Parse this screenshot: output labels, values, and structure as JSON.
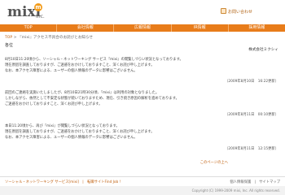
{
  "header": {
    "logo_text": "mixi",
    "logo_badge": "m",
    "logo_suffix": "Inc.",
    "util_link": "お問い合わせ"
  },
  "nav": {
    "items": [
      "TOP",
      "会社情報",
      "広報情報",
      "IR情報",
      "採用情報"
    ]
  },
  "breadcrumb": {
    "top": "TOP",
    "separator": " > ",
    "current": "『mixi』アクセス不具合のお詫びとお知らせ"
  },
  "section_title": "各位",
  "company": "株式会社ミクシィ",
  "paragraphs": [
    {
      "lines": [
        "8月10日11:20頃から、ソーシャル・ネットワーキング サービス『mixi』の閲覧しづらい状況となっております。",
        "現在原因を調査しておりますが、ご迷惑をおかけしておりますこと、深くお詫び申し上げます。",
        "なお、本アクセス障害による、ユーザーの個人情報のデータに影響はございません。"
      ],
      "date": "（2009年8月10日　16:22更新）"
    },
    {
      "lines": [
        "前回のご連絡を実施いたしましたが、8月10日21時30分頃、『mixi』は利用の対象となりました。",
        "しかしながら、依然として不安定な状態が続いておりますため、現在、引き続き原因の解析を進めております。",
        "ご迷惑をおかけしておりますこと、深くお詫び申し上げます。"
      ],
      "date": "（2009年8月11日　00:10更新）"
    },
    {
      "lines": [
        "本日11:20頃から、再び『mixi』が閲覧しづらい状況となっております。",
        "現在原因を調査しておりますが、ご迷惑をおかけしておりますこと、深くお詫び申し上げます。",
        "なお、本アクセス障害による、ユーザーの個人情報のデータに影響はございません。"
      ],
      "date": "（2009年8月11日　12:15更新）"
    }
  ],
  "more_link": "このページの上へ",
  "footer": {
    "left": "ソーシャル・ネットワーキング サービス[mixi]　|　転職サイトFind Job !",
    "right": "個人情報保護　|　サイトマップ",
    "copyright": "Copyright (C) 1999-2009 mixi, Inc. All rights reserved."
  },
  "colors": {
    "accent": "#e87c1a",
    "link": "#c06010"
  }
}
